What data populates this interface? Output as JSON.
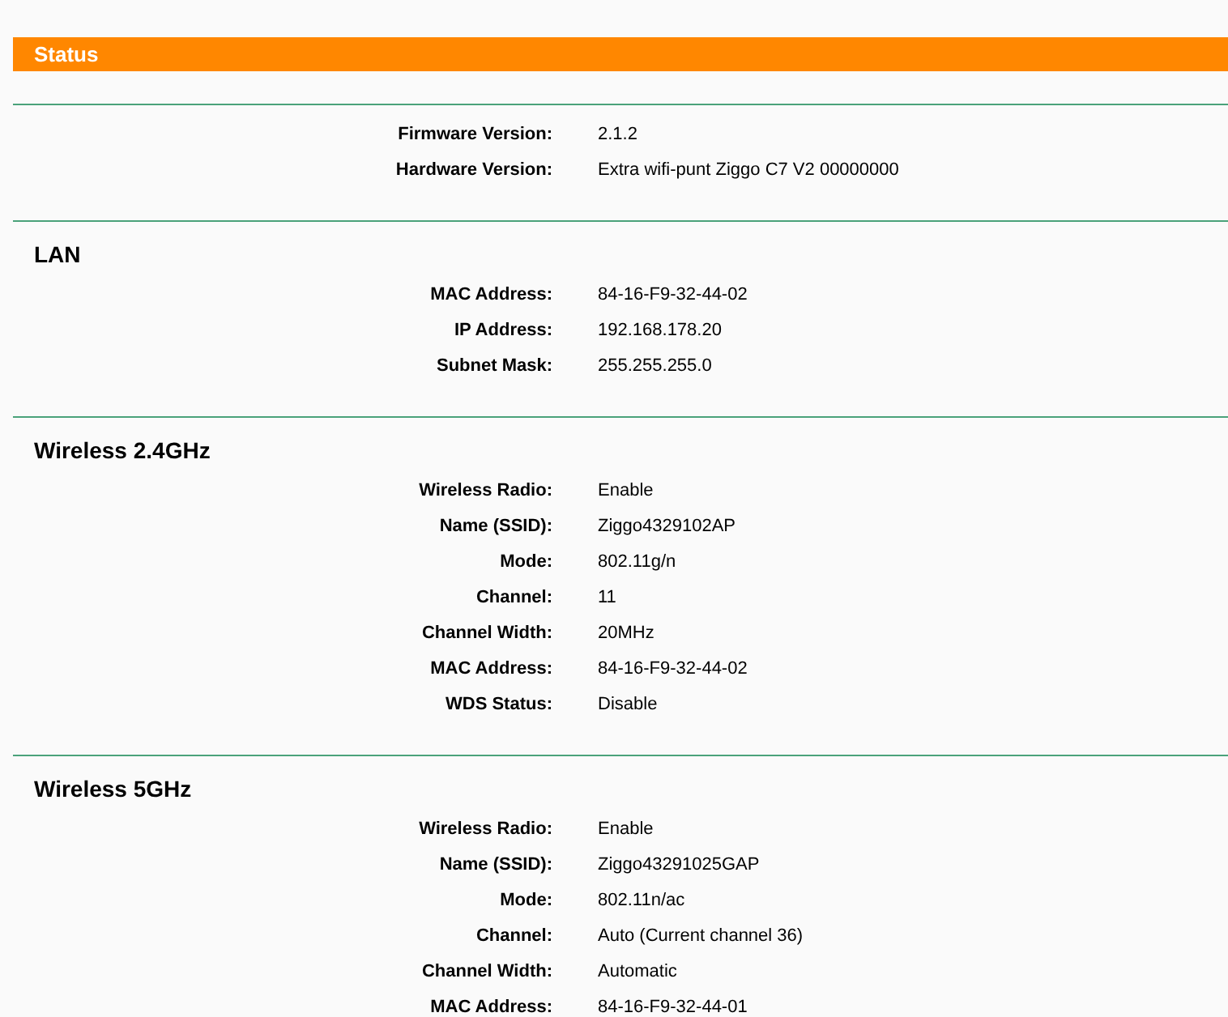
{
  "header": {
    "title": "Status"
  },
  "sections": [
    {
      "rows": [
        {
          "label": "Firmware Version:",
          "value": "2.1.2"
        },
        {
          "label": "Hardware Version:",
          "value": "Extra wifi-punt Ziggo C7 V2 00000000"
        }
      ]
    },
    {
      "title": "LAN",
      "rows": [
        {
          "label": "MAC Address:",
          "value": "84-16-F9-32-44-02"
        },
        {
          "label": "IP Address:",
          "value": "192.168.178.20"
        },
        {
          "label": "Subnet Mask:",
          "value": "255.255.255.0"
        }
      ]
    },
    {
      "title": "Wireless 2.4GHz",
      "rows": [
        {
          "label": "Wireless Radio:",
          "value": "Enable"
        },
        {
          "label": "Name (SSID):",
          "value": "Ziggo4329102AP"
        },
        {
          "label": "Mode:",
          "value": "802.11g/n"
        },
        {
          "label": "Channel:",
          "value": "11"
        },
        {
          "label": "Channel Width:",
          "value": "20MHz"
        },
        {
          "label": "MAC Address:",
          "value": "84-16-F9-32-44-02"
        },
        {
          "label": "WDS Status:",
          "value": "Disable"
        }
      ]
    },
    {
      "title": "Wireless 5GHz",
      "rows": [
        {
          "label": "Wireless Radio:",
          "value": "Enable"
        },
        {
          "label": "Name (SSID):",
          "value": "Ziggo43291025GAP"
        },
        {
          "label": "Mode:",
          "value": "802.11n/ac"
        },
        {
          "label": "Channel:",
          "value": "Auto (Current channel 36)"
        },
        {
          "label": "Channel Width:",
          "value": "Automatic"
        },
        {
          "label": "MAC Address:",
          "value": "84-16-F9-32-44-01"
        }
      ]
    }
  ]
}
